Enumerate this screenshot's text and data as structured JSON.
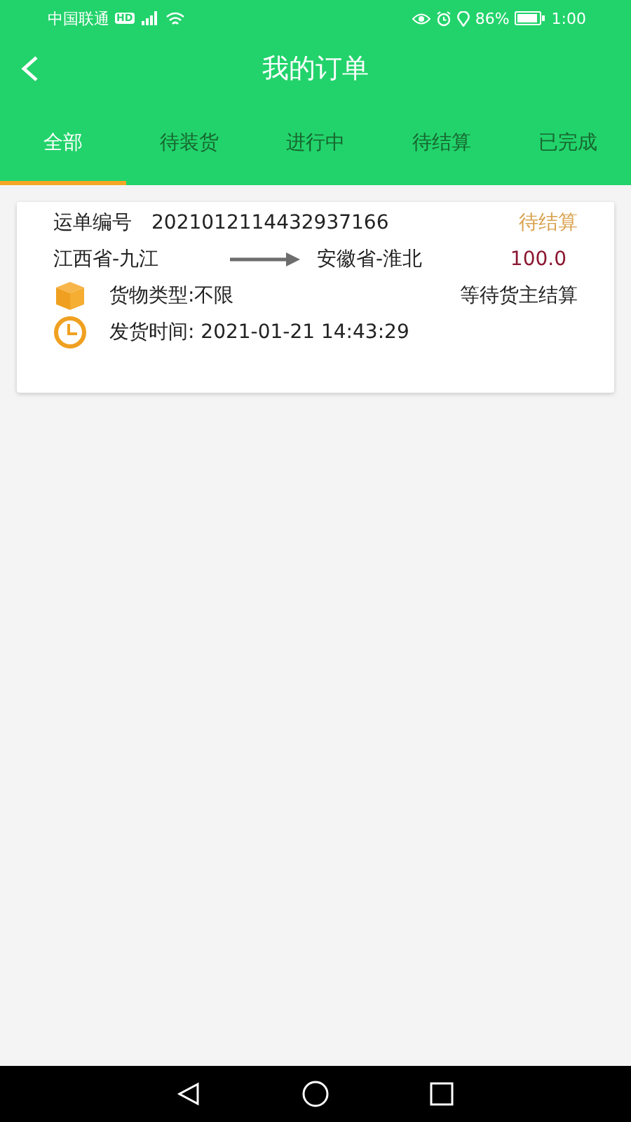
{
  "status_bar": {
    "carrier": "中国联通",
    "hd_badge": "HD",
    "battery_percent": "86%",
    "time": "1:00"
  },
  "header": {
    "title": "我的订单"
  },
  "tabs": [
    {
      "label": "全部",
      "selected": true
    },
    {
      "label": "待装货",
      "selected": false
    },
    {
      "label": "进行中",
      "selected": false
    },
    {
      "label": "待结算",
      "selected": false
    },
    {
      "label": "已完成",
      "selected": false
    }
  ],
  "orders": [
    {
      "waybill_label": "运单编号",
      "waybill_number": "2021012114432937166",
      "status": "待结算",
      "origin": "江西省-九江",
      "destination": "安徽省-淮北",
      "price": "100.0",
      "cargo_type": "货物类型:不限",
      "progress": "等待货主结算",
      "ship_time": "发货时间: 2021-01-21 14:43:29"
    }
  ]
}
